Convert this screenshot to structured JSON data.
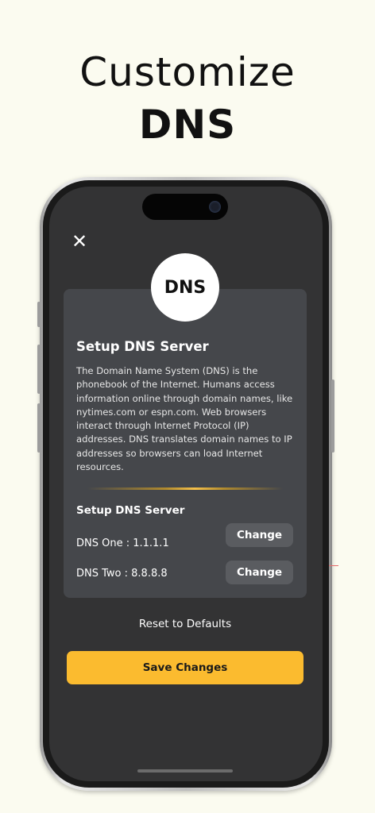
{
  "headline": {
    "line1": "Customize",
    "line2": "DNS"
  },
  "close_icon_glyph": "✕",
  "logo": {
    "text": "DNS"
  },
  "card": {
    "title": "Setup DNS Server",
    "description": "The Domain Name System (DNS) is the phonebook of the Internet. Humans access information online through domain names, like nytimes.com or espn.com. Web browsers interact through Internet Protocol (IP) addresses. DNS translates domain names to IP addresses so browsers can load Internet resources.",
    "section_title": "Setup DNS Server",
    "dns_one_label": "DNS One : 1.1.1.1",
    "dns_two_label": "DNS Two : 8.8.8.8",
    "change_one_label": "Change",
    "change_two_label": "Change"
  },
  "actions": {
    "reset_label": "Reset to Defaults",
    "save_label": "Save Changes"
  },
  "colors": {
    "background": "#fbfbf0",
    "screen": "#333334",
    "card": "#45474b",
    "accent": "#fbbb2f",
    "change_button": "#5a5c60"
  }
}
